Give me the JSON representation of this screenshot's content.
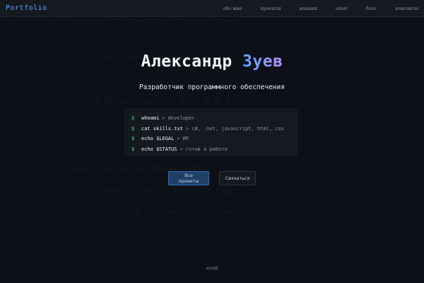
{
  "header": {
    "brand": "Portfolio",
    "nav": [
      "обо мне",
      "проекты",
      "навыки",
      "опыт",
      "блог",
      "контакты"
    ]
  },
  "hero": {
    "first_name": "Александр",
    "last_name": "Зуев",
    "subtitle": "Разработчик программного обеспечения"
  },
  "terminal": {
    "lines": [
      {
        "prompt": "$",
        "cmd": "whoami",
        "arrow": ">",
        "out": "developer"
      },
      {
        "prompt": "$",
        "cmd": "cat skills.txt",
        "arrow": ">",
        "out": "c#, .net, javascript, html, css"
      },
      {
        "prompt": "$",
        "cmd": "echo $LEGAL",
        "arrow": ">",
        "out": "ИП"
      },
      {
        "prompt": "$",
        "cmd": "echo $STATUS",
        "arrow": ">",
        "out": "готов к работе"
      }
    ]
  },
  "buttons": {
    "primary": "Все проекты",
    "secondary": "Связаться"
  },
  "scroll_label": "scroll",
  "background_code": [
    "d-template-columns: repeat(auto-fill, minmax(280px, 1fr)); gap: 1.5rem;",
    "users = _db.Users.Where(u => u.Age > 18).ToList();",
    "name=\"viewport\" content=\"width=device-width, initial-scale=1.0\">",
    "lientListData(a = JSON).filter(x=>x.active)",
    "transition: all 0.3s cubic-bezier(0.4, 0, 0.2, 1);",
    "linear-gradient(135deg, #667eea 0%, #764ba2 100%)",
    "t fetch(url, {method: 'POST', headers: {'Content-Type'...",
    "Promise((resolve, reject) => { setTimeout(() => resolve('done'), 1000); });",
    "localStorage.setItem('token', JSON.stringify(response));",
    "<svg viewBox=\"0 0 24 24\" fill=\"none\" stroke=\"currentColor\"><path d=\"...\" /></svg>"
  ],
  "colors": {
    "accent": "#58a6ff",
    "accent2": "#b48ef7",
    "prompt": "#3fb950",
    "background": "#0d1117"
  }
}
